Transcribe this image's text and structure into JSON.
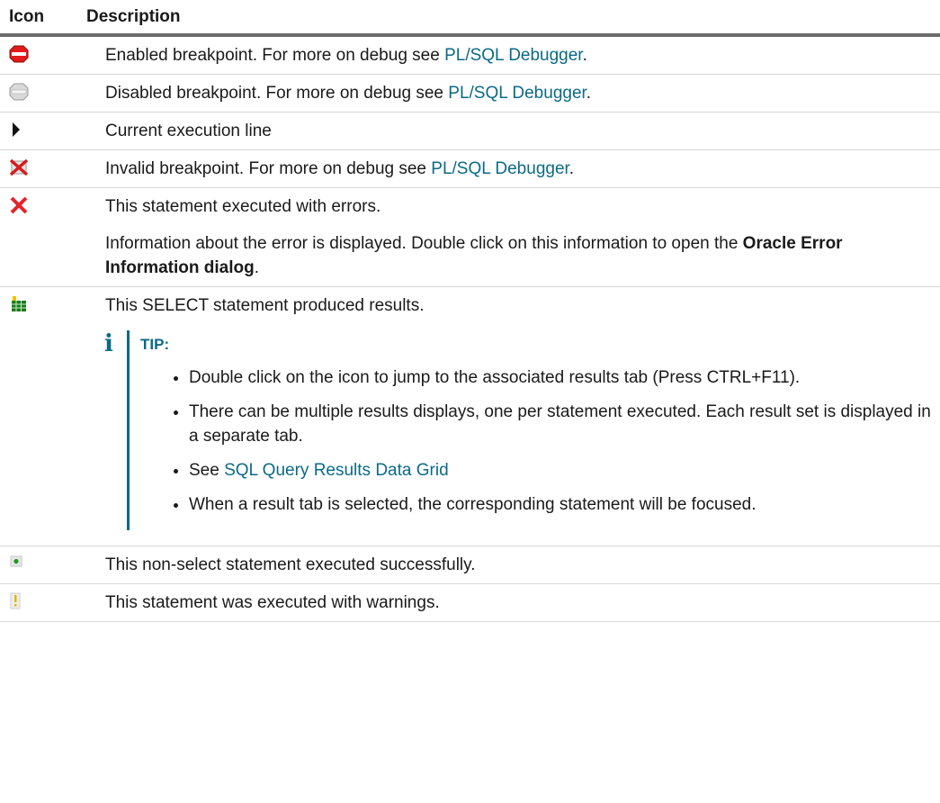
{
  "table": {
    "headers": {
      "icon": "Icon",
      "description": "Description"
    },
    "rows": [
      {
        "icon": "enabled-breakpoint-icon",
        "text_before": "Enabled breakpoint. For more on debug see ",
        "link": "PL/SQL Debugger",
        "text_after": "."
      },
      {
        "icon": "disabled-breakpoint-icon",
        "text_before": "Disabled breakpoint. For more on debug see ",
        "link": "PL/SQL Debugger",
        "text_after": "."
      },
      {
        "icon": "execution-arrow-icon",
        "text": "Current execution line"
      },
      {
        "icon": "invalid-breakpoint-icon",
        "text_before": "Invalid breakpoint. For more on debug see ",
        "link": "PL/SQL Debugger",
        "text_after": "."
      },
      {
        "icon": "error-x-icon",
        "text": "This statement executed with errors.",
        "detail_before": "Information about the error is displayed. Double click on this information to open the ",
        "detail_bold": "Oracle Error Information dialog",
        "detail_after": "."
      },
      {
        "icon": "results-grid-icon",
        "text": "This SELECT statement produced results.",
        "tip": {
          "icon": "info-icon",
          "label": "TIP:",
          "items": {
            "0": "Double click on the icon to jump to the associated results tab (Press CTRL+F11).",
            "1": "There can be multiple results displays, one per statement executed. Each result set is displayed in a separate tab.",
            "2_prefix": "See ",
            "2_link": "SQL Query Results Data Grid",
            "3": "When a result tab is selected, the corresponding statement will be focused."
          }
        }
      },
      {
        "icon": "success-icon",
        "text": "This non-select statement executed successfully."
      },
      {
        "icon": "warning-icon",
        "text": "This statement was executed with warnings."
      }
    ]
  },
  "colors": {
    "link": "#0b6a86",
    "header_rule": "#6b6b6b",
    "row_rule": "#d7d7d7"
  }
}
